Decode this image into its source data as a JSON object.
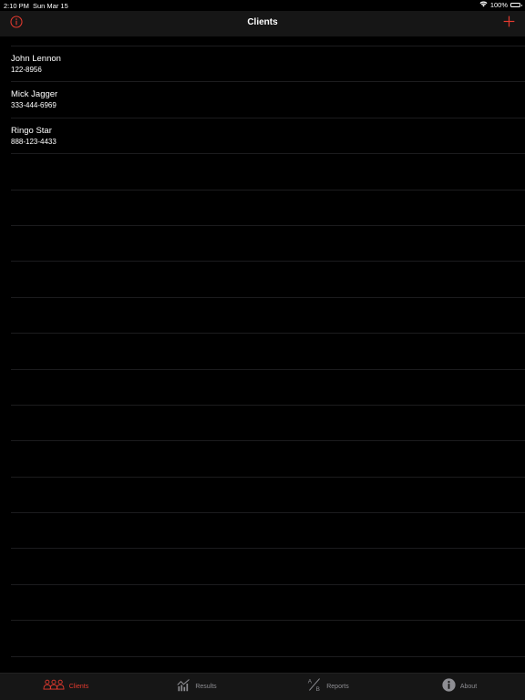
{
  "status_bar": {
    "time": "2:10 PM",
    "date": "Sun Mar 15",
    "battery": "100%",
    "wifi_icon": "wifi-icon",
    "battery_icon": "battery-icon"
  },
  "nav": {
    "title": "Clients",
    "left_icon": "info-circle-icon",
    "right_icon": "plus-icon",
    "accent_color": "#e53a2f"
  },
  "clients": [
    {
      "name": "John Lennon",
      "phone": "122-8956"
    },
    {
      "name": "Mick Jagger",
      "phone": "333-444-6969"
    },
    {
      "name": "Ringo Star",
      "phone": "888-123-4433"
    }
  ],
  "tabs": [
    {
      "label": "Clients",
      "icon": "people-icon",
      "active": true
    },
    {
      "label": "Results",
      "icon": "chart-icon",
      "active": false
    },
    {
      "label": "Reports",
      "icon": "ab-icon",
      "active": false
    },
    {
      "label": "About",
      "icon": "info-icon",
      "active": false
    }
  ],
  "colors": {
    "background": "#000000",
    "bar_background": "#161616",
    "accent": "#e53a2f",
    "inactive_tab": "#8e8e93"
  }
}
